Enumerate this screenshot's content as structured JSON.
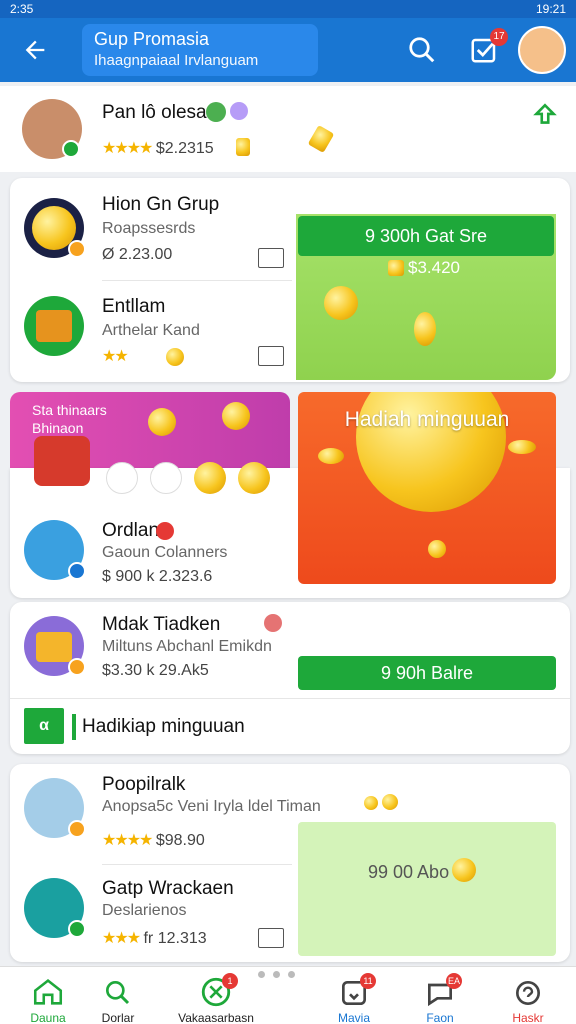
{
  "status": {
    "time": "19:21",
    "left": "2:35"
  },
  "header": {
    "title": "Gup Promasia",
    "subtitle": "Ihaagnpaiaal Irvlanguam",
    "notif_count": "17"
  },
  "top_profile": {
    "name": "Pan lô olesan",
    "stars": "★★★★",
    "amount": "$2.2315"
  },
  "card1": {
    "row1": {
      "name": "Hion Gn Grup",
      "sub": "Roapssesrds",
      "meta": "Ø 2.23.00"
    },
    "row2": {
      "name": "Entllam",
      "sub": "Arthelar Kand",
      "stars": "★★"
    },
    "green_banner": {
      "label": "9 300h Gat Sre",
      "amount": "$3.420"
    }
  },
  "promo_banner": {
    "line1": "Sta thinaars",
    "line2": "Bhinaon"
  },
  "big_promo": {
    "label": "Hadiah minguuan"
  },
  "card2_row": {
    "name": "Ordlan",
    "sub": "Gaoun Colanners",
    "meta": "$ 900 k 2.323.6"
  },
  "card3": {
    "row1": {
      "name": "Mdak Tiadken",
      "sub": "Miltuns Abchanl Emikdn",
      "meta": "$3.30 k 29.Ak5"
    },
    "green_button": "9 90h Balre",
    "banner": "Hadikiap minguuan",
    "banner_icon": "α"
  },
  "card4": {
    "row1": {
      "name": "Poopilralk",
      "sub": "Anopsa5c Veni Iryla ldel Timan",
      "stars": "★★★★",
      "amount": "$98.90"
    },
    "row2": {
      "name": "Gatp Wrackaen",
      "sub": "Deslarienos",
      "stars": "★★★",
      "amount": "fr 12.313"
    },
    "green_box": "99 00 Abo"
  },
  "nav": {
    "items": [
      {
        "label": "Dauna",
        "icon": "home-icon"
      },
      {
        "label": "Dorlar",
        "icon": "search-icon"
      },
      {
        "label": "Vakaasarbasn",
        "icon": "grid-icon",
        "badge": "1"
      },
      {
        "label": "Mavia",
        "icon": "chat-icon",
        "badge": "11"
      },
      {
        "label": "Faon",
        "icon": "heart-icon",
        "badge": "EA"
      },
      {
        "label": "Haskr",
        "icon": "support-icon"
      }
    ]
  },
  "colors": {
    "primary": "#1976d2",
    "green": "#1ea83a",
    "orange": "#f45b1e",
    "gold": "#f7c51e"
  }
}
